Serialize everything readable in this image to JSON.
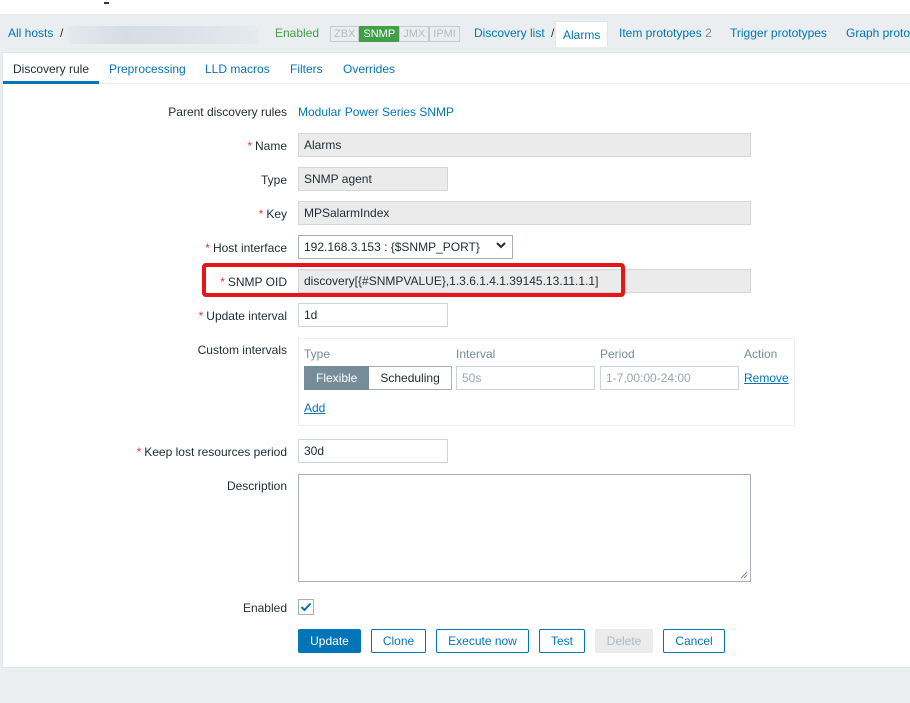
{
  "breadcrumb": {
    "all_hosts": "All hosts",
    "separator": "/",
    "host_status": "Enabled",
    "availability": [
      "ZBX",
      "SNMP",
      "JMX",
      "IPMI"
    ],
    "discovery_list": "Discovery list",
    "current_rule": "Alarms",
    "item_prototypes": "Item prototypes",
    "item_prototypes_count": "2",
    "trigger_prototypes": "Trigger prototypes",
    "graph_prototypes": "Graph proto"
  },
  "tabs": [
    "Discovery rule",
    "Preprocessing",
    "LLD macros",
    "Filters",
    "Overrides"
  ],
  "form": {
    "required_mark": "*",
    "parent_label": "Parent discovery rules",
    "parent_value": "Modular Power Series SNMP",
    "name_label": "Name",
    "name_value": "Alarms",
    "type_label": "Type",
    "type_value": "SNMP agent",
    "key_label": "Key",
    "key_value": "MPSalarmIndex",
    "host_interface_label": "Host interface",
    "host_interface_value": "192.168.3.153 : {$SNMP_PORT}",
    "snmp_oid_label": "SNMP OID",
    "snmp_oid_value": "discovery[{#SNMPVALUE},1.3.6.1.4.1.39145.13.11.1.1]",
    "update_interval_label": "Update interval",
    "update_interval_value": "1d",
    "custom_intervals_label": "Custom intervals",
    "custom_intervals": {
      "col_type": "Type",
      "col_interval": "Interval",
      "col_period": "Period",
      "col_action": "Action",
      "flexible": "Flexible",
      "scheduling": "Scheduling",
      "interval_placeholder": "50s",
      "period_placeholder": "1-7,00:00-24:00",
      "remove": "Remove",
      "add": "Add"
    },
    "keep_lost_label": "Keep lost resources period",
    "keep_lost_value": "30d",
    "description_label": "Description",
    "description_value": "",
    "enabled_label": "Enabled",
    "enabled_checked": true
  },
  "buttons": {
    "update": "Update",
    "clone": "Clone",
    "execute_now": "Execute now",
    "test": "Test",
    "delete": "Delete",
    "cancel": "Cancel"
  },
  "colors": {
    "link": "#0275b8",
    "enabled_green": "#429e47",
    "required_red": "#e33734",
    "highlight_red": "#e8141c"
  }
}
